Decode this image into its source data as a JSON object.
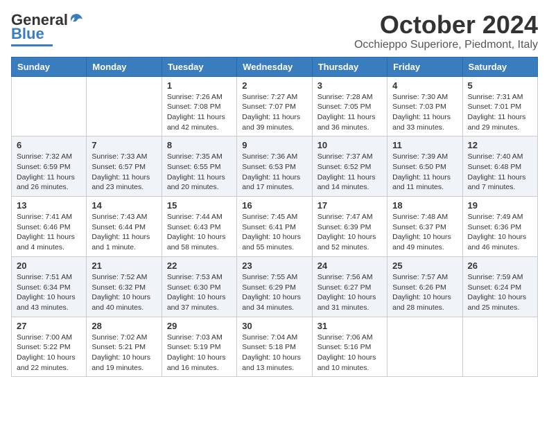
{
  "header": {
    "logo_general": "General",
    "logo_blue": "Blue",
    "month": "October 2024",
    "location": "Occhieppo Superiore, Piedmont, Italy"
  },
  "weekdays": [
    "Sunday",
    "Monday",
    "Tuesday",
    "Wednesday",
    "Thursday",
    "Friday",
    "Saturday"
  ],
  "weeks": [
    [
      {
        "day": "",
        "info": ""
      },
      {
        "day": "",
        "info": ""
      },
      {
        "day": "1",
        "info": "Sunrise: 7:26 AM\nSunset: 7:08 PM\nDaylight: 11 hours\nand 42 minutes."
      },
      {
        "day": "2",
        "info": "Sunrise: 7:27 AM\nSunset: 7:07 PM\nDaylight: 11 hours\nand 39 minutes."
      },
      {
        "day": "3",
        "info": "Sunrise: 7:28 AM\nSunset: 7:05 PM\nDaylight: 11 hours\nand 36 minutes."
      },
      {
        "day": "4",
        "info": "Sunrise: 7:30 AM\nSunset: 7:03 PM\nDaylight: 11 hours\nand 33 minutes."
      },
      {
        "day": "5",
        "info": "Sunrise: 7:31 AM\nSunset: 7:01 PM\nDaylight: 11 hours\nand 29 minutes."
      }
    ],
    [
      {
        "day": "6",
        "info": "Sunrise: 7:32 AM\nSunset: 6:59 PM\nDaylight: 11 hours\nand 26 minutes."
      },
      {
        "day": "7",
        "info": "Sunrise: 7:33 AM\nSunset: 6:57 PM\nDaylight: 11 hours\nand 23 minutes."
      },
      {
        "day": "8",
        "info": "Sunrise: 7:35 AM\nSunset: 6:55 PM\nDaylight: 11 hours\nand 20 minutes."
      },
      {
        "day": "9",
        "info": "Sunrise: 7:36 AM\nSunset: 6:53 PM\nDaylight: 11 hours\nand 17 minutes."
      },
      {
        "day": "10",
        "info": "Sunrise: 7:37 AM\nSunset: 6:52 PM\nDaylight: 11 hours\nand 14 minutes."
      },
      {
        "day": "11",
        "info": "Sunrise: 7:39 AM\nSunset: 6:50 PM\nDaylight: 11 hours\nand 11 minutes."
      },
      {
        "day": "12",
        "info": "Sunrise: 7:40 AM\nSunset: 6:48 PM\nDaylight: 11 hours\nand 7 minutes."
      }
    ],
    [
      {
        "day": "13",
        "info": "Sunrise: 7:41 AM\nSunset: 6:46 PM\nDaylight: 11 hours\nand 4 minutes."
      },
      {
        "day": "14",
        "info": "Sunrise: 7:43 AM\nSunset: 6:44 PM\nDaylight: 11 hours\nand 1 minute."
      },
      {
        "day": "15",
        "info": "Sunrise: 7:44 AM\nSunset: 6:43 PM\nDaylight: 10 hours\nand 58 minutes."
      },
      {
        "day": "16",
        "info": "Sunrise: 7:45 AM\nSunset: 6:41 PM\nDaylight: 10 hours\nand 55 minutes."
      },
      {
        "day": "17",
        "info": "Sunrise: 7:47 AM\nSunset: 6:39 PM\nDaylight: 10 hours\nand 52 minutes."
      },
      {
        "day": "18",
        "info": "Sunrise: 7:48 AM\nSunset: 6:37 PM\nDaylight: 10 hours\nand 49 minutes."
      },
      {
        "day": "19",
        "info": "Sunrise: 7:49 AM\nSunset: 6:36 PM\nDaylight: 10 hours\nand 46 minutes."
      }
    ],
    [
      {
        "day": "20",
        "info": "Sunrise: 7:51 AM\nSunset: 6:34 PM\nDaylight: 10 hours\nand 43 minutes."
      },
      {
        "day": "21",
        "info": "Sunrise: 7:52 AM\nSunset: 6:32 PM\nDaylight: 10 hours\nand 40 minutes."
      },
      {
        "day": "22",
        "info": "Sunrise: 7:53 AM\nSunset: 6:30 PM\nDaylight: 10 hours\nand 37 minutes."
      },
      {
        "day": "23",
        "info": "Sunrise: 7:55 AM\nSunset: 6:29 PM\nDaylight: 10 hours\nand 34 minutes."
      },
      {
        "day": "24",
        "info": "Sunrise: 7:56 AM\nSunset: 6:27 PM\nDaylight: 10 hours\nand 31 minutes."
      },
      {
        "day": "25",
        "info": "Sunrise: 7:57 AM\nSunset: 6:26 PM\nDaylight: 10 hours\nand 28 minutes."
      },
      {
        "day": "26",
        "info": "Sunrise: 7:59 AM\nSunset: 6:24 PM\nDaylight: 10 hours\nand 25 minutes."
      }
    ],
    [
      {
        "day": "27",
        "info": "Sunrise: 7:00 AM\nSunset: 5:22 PM\nDaylight: 10 hours\nand 22 minutes."
      },
      {
        "day": "28",
        "info": "Sunrise: 7:02 AM\nSunset: 5:21 PM\nDaylight: 10 hours\nand 19 minutes."
      },
      {
        "day": "29",
        "info": "Sunrise: 7:03 AM\nSunset: 5:19 PM\nDaylight: 10 hours\nand 16 minutes."
      },
      {
        "day": "30",
        "info": "Sunrise: 7:04 AM\nSunset: 5:18 PM\nDaylight: 10 hours\nand 13 minutes."
      },
      {
        "day": "31",
        "info": "Sunrise: 7:06 AM\nSunset: 5:16 PM\nDaylight: 10 hours\nand 10 minutes."
      },
      {
        "day": "",
        "info": ""
      },
      {
        "day": "",
        "info": ""
      }
    ]
  ]
}
